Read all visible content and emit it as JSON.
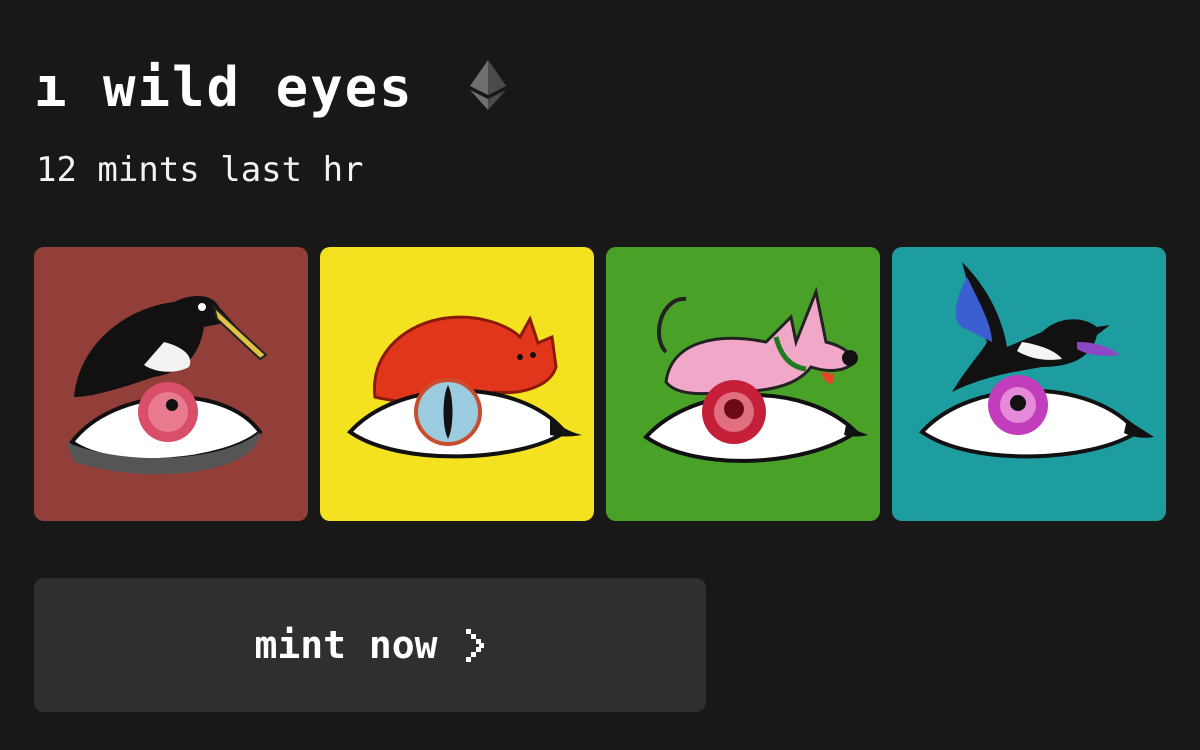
{
  "collection": {
    "title": "ı wild eyes",
    "chain_icon": "ethereum-icon",
    "mints_label": "12 mints last hr"
  },
  "gallery": {
    "items": [
      {
        "name": "crow-eye",
        "background": "#8e3a36",
        "iris": "#d94f6a"
      },
      {
        "name": "fox-eye",
        "background": "#f4e11f",
        "iris": "#9ccbe0"
      },
      {
        "name": "dog-eye",
        "background": "#4fa72a",
        "iris": "#c51f3a"
      },
      {
        "name": "magpie-eye",
        "background": "#1fa3a6",
        "iris": "#c23dbb"
      }
    ]
  },
  "actions": {
    "mint_label": "mint now",
    "mint_icon": "chevron-right-icon"
  },
  "colors": {
    "page_background": "#181818",
    "button_background": "#2f2f2f",
    "text": "#ffffff"
  }
}
